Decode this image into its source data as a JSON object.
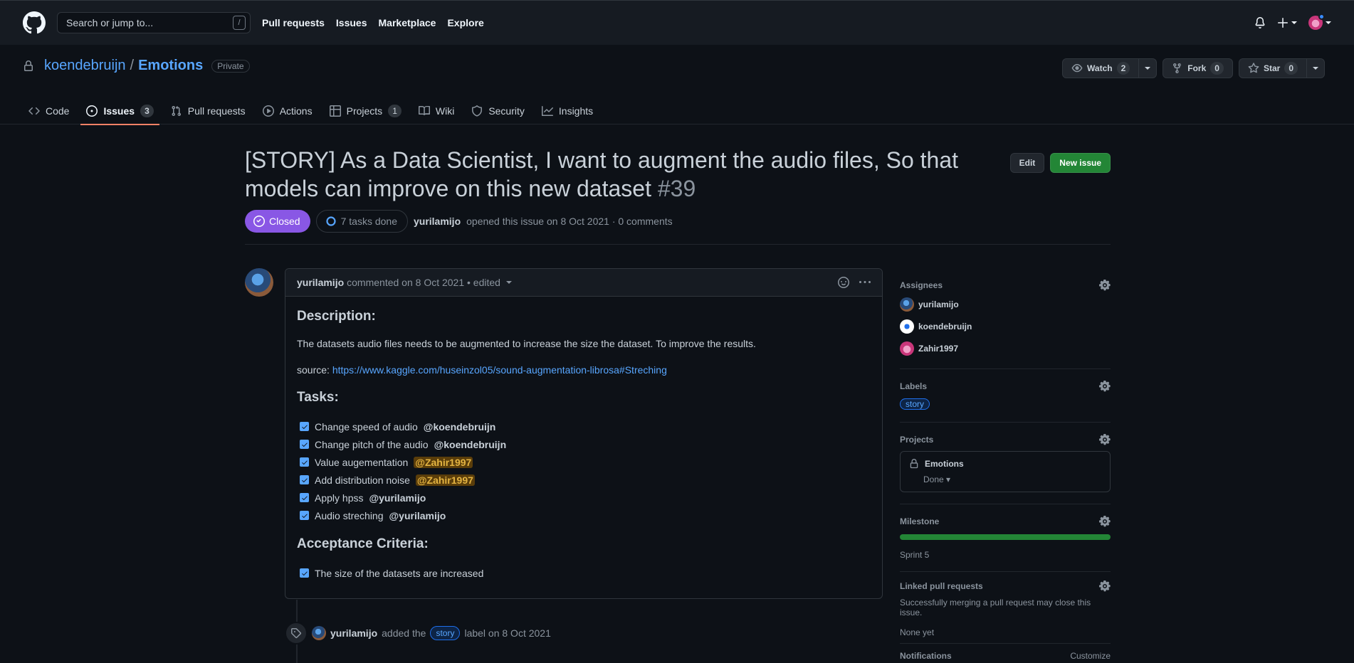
{
  "header": {
    "search_placeholder": "Search or jump to...",
    "search_shortcut": "/",
    "nav": [
      "Pull requests",
      "Issues",
      "Marketplace",
      "Explore"
    ]
  },
  "repo": {
    "owner": "koendebruijn",
    "separator": "/",
    "name": "Emotions",
    "visibility": "Private",
    "watch_label": "Watch",
    "watch_count": "2",
    "fork_label": "Fork",
    "fork_count": "0",
    "star_label": "Star",
    "star_count": "0"
  },
  "tabs": [
    {
      "label": "Code",
      "icon": "code-icon"
    },
    {
      "label": "Issues",
      "icon": "issue-opened-icon",
      "count": "3",
      "active": true
    },
    {
      "label": "Pull requests",
      "icon": "git-pull-request-icon"
    },
    {
      "label": "Actions",
      "icon": "play-icon"
    },
    {
      "label": "Projects",
      "icon": "table-icon",
      "count": "1"
    },
    {
      "label": "Wiki",
      "icon": "book-icon"
    },
    {
      "label": "Security",
      "icon": "shield-icon"
    },
    {
      "label": "Insights",
      "icon": "graph-icon"
    }
  ],
  "issue": {
    "title": "[STORY] As a Data Scientist, I want to augment the audio files, So that models can improve on this new dataset",
    "number": "#39",
    "edit_label": "Edit",
    "new_issue_label": "New issue",
    "state": "Closed",
    "tasks_done": "7 tasks done",
    "author": "yurilamijo",
    "opened_text": "opened this issue on 8 Oct 2021 · 0 comments"
  },
  "comment": {
    "author": "yurilamijo",
    "meta": "commented on 8 Oct 2021 • edited",
    "description_heading": "Description:",
    "description_text": "The datasets audio files needs to be augmented to increase the size the dataset. To improve the results.",
    "source_label": "source:",
    "source_link": "https://www.kaggle.com/huseinzol05/sound-augmentation-librosa#Streching",
    "tasks_heading": "Tasks:",
    "tasks": [
      {
        "text": "Change speed of audio",
        "mention": "@koendebruijn",
        "highlight": false
      },
      {
        "text": "Change pitch of the audio",
        "mention": "@koendebruijn",
        "highlight": false
      },
      {
        "text": "Value augementation",
        "mention": "@Zahir1997",
        "highlight": true
      },
      {
        "text": "Add distribution noise",
        "mention": "@Zahir1997",
        "highlight": true
      },
      {
        "text": "Apply hpss",
        "mention": "@yurilamijo",
        "highlight": false
      },
      {
        "text": "Audio streching",
        "mention": "@yurilamijo",
        "highlight": false
      }
    ],
    "criteria_heading": "Acceptance Criteria:",
    "criteria": [
      "The size of the datasets are increased"
    ]
  },
  "timeline": {
    "actor": "yurilamijo",
    "action": "added the",
    "label": "story",
    "suffix": "label on 8 Oct 2021"
  },
  "sidebar": {
    "assignees_title": "Assignees",
    "assignees": [
      "yurilamijo",
      "koendebruijn",
      "Zahir1997"
    ],
    "labels_title": "Labels",
    "label": "story",
    "projects_title": "Projects",
    "project_name": "Emotions",
    "project_status": "Done",
    "milestone_title": "Milestone",
    "milestone_name": "Sprint 5",
    "milestone_progress": 1.0,
    "linked_title": "Linked pull requests",
    "linked_text": "Successfully merging a pull request may close this issue.",
    "linked_none": "None yet",
    "notifications_title": "Notifications",
    "customize_label": "Customize"
  },
  "colors": {
    "closed": "#8957e5",
    "new_issue": "#238636",
    "link": "#58a6ff",
    "active_tab": "#f78166"
  }
}
